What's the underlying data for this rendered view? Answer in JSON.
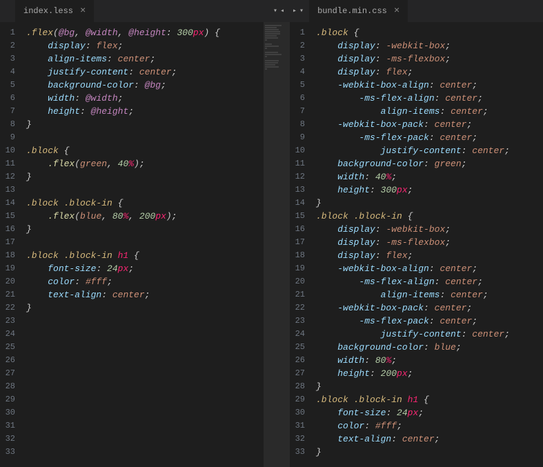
{
  "left": {
    "tab_title": "index.less",
    "lines": [
      [
        [
          "c-sel",
          ".flex"
        ],
        [
          "c-punc",
          "("
        ],
        [
          "c-var",
          "@bg"
        ],
        [
          "c-punc",
          ", "
        ],
        [
          "c-var",
          "@width"
        ],
        [
          "c-punc",
          ", "
        ],
        [
          "c-var",
          "@height"
        ],
        [
          "c-punc",
          ": "
        ],
        [
          "c-num",
          "300"
        ],
        [
          "c-unit",
          "px"
        ],
        [
          "c-punc",
          ") {"
        ]
      ],
      [
        [
          "",
          "    "
        ],
        [
          "c-prop",
          "display"
        ],
        [
          "c-punc",
          ": "
        ],
        [
          "c-val",
          "flex"
        ],
        [
          "c-punc",
          ";"
        ]
      ],
      [
        [
          "",
          "    "
        ],
        [
          "c-prop",
          "align-items"
        ],
        [
          "c-punc",
          ": "
        ],
        [
          "c-val",
          "center"
        ],
        [
          "c-punc",
          ";"
        ]
      ],
      [
        [
          "",
          "    "
        ],
        [
          "c-prop",
          "justify-content"
        ],
        [
          "c-punc",
          ": "
        ],
        [
          "c-val",
          "center"
        ],
        [
          "c-punc",
          ";"
        ]
      ],
      [
        [
          "",
          "    "
        ],
        [
          "c-prop",
          "background-color"
        ],
        [
          "c-punc",
          ": "
        ],
        [
          "c-var",
          "@bg"
        ],
        [
          "c-punc",
          ";"
        ]
      ],
      [
        [
          "",
          "    "
        ],
        [
          "c-prop",
          "width"
        ],
        [
          "c-punc",
          ": "
        ],
        [
          "c-var",
          "@width"
        ],
        [
          "c-punc",
          ";"
        ]
      ],
      [
        [
          "",
          "    "
        ],
        [
          "c-prop",
          "height"
        ],
        [
          "c-punc",
          ": "
        ],
        [
          "c-var",
          "@height"
        ],
        [
          "c-punc",
          ";"
        ]
      ],
      [
        [
          "c-punc",
          "}"
        ]
      ],
      [
        [
          "",
          ""
        ]
      ],
      [
        [
          "c-sel",
          ".block"
        ],
        [
          "c-punc",
          " {"
        ]
      ],
      [
        [
          "",
          "    "
        ],
        [
          "c-func",
          ".flex"
        ],
        [
          "c-punc",
          "("
        ],
        [
          "c-val",
          "green"
        ],
        [
          "c-punc",
          ", "
        ],
        [
          "c-num",
          "40"
        ],
        [
          "c-unit",
          "%"
        ],
        [
          "c-punc",
          ");"
        ]
      ],
      [
        [
          "c-punc",
          "}"
        ]
      ],
      [
        [
          "",
          ""
        ]
      ],
      [
        [
          "c-sel",
          ".block "
        ],
        [
          "c-sel",
          ".block-in"
        ],
        [
          "c-punc",
          " {"
        ]
      ],
      [
        [
          "",
          "    "
        ],
        [
          "c-func",
          ".flex"
        ],
        [
          "c-punc",
          "("
        ],
        [
          "c-val",
          "blue"
        ],
        [
          "c-punc",
          ", "
        ],
        [
          "c-num",
          "80"
        ],
        [
          "c-unit",
          "%"
        ],
        [
          "c-punc",
          ", "
        ],
        [
          "c-num",
          "200"
        ],
        [
          "c-unit",
          "px"
        ],
        [
          "c-punc",
          ");"
        ]
      ],
      [
        [
          "c-punc",
          "}"
        ]
      ],
      [
        [
          "",
          ""
        ]
      ],
      [
        [
          "c-sel",
          ".block "
        ],
        [
          "c-sel",
          ".block-in "
        ],
        [
          "c-tag",
          "h1"
        ],
        [
          "c-punc",
          " {"
        ]
      ],
      [
        [
          "",
          "    "
        ],
        [
          "c-prop",
          "font-size"
        ],
        [
          "c-punc",
          ": "
        ],
        [
          "c-num",
          "24"
        ],
        [
          "c-unit",
          "px"
        ],
        [
          "c-punc",
          ";"
        ]
      ],
      [
        [
          "",
          "    "
        ],
        [
          "c-prop",
          "color"
        ],
        [
          "c-punc",
          ": "
        ],
        [
          "c-val",
          "#fff"
        ],
        [
          "c-punc",
          ";"
        ]
      ],
      [
        [
          "",
          "    "
        ],
        [
          "c-prop",
          "text-align"
        ],
        [
          "c-punc",
          ": "
        ],
        [
          "c-val",
          "center"
        ],
        [
          "c-punc",
          ";"
        ]
      ],
      [
        [
          "c-punc",
          "}"
        ]
      ],
      [
        [
          "",
          ""
        ]
      ]
    ]
  },
  "right": {
    "tab_title": "bundle.min.css",
    "lines": [
      [
        [
          "c-sel",
          ".block"
        ],
        [
          "c-punc",
          " {"
        ]
      ],
      [
        [
          "",
          "    "
        ],
        [
          "c-prop",
          "display"
        ],
        [
          "c-punc",
          ": "
        ],
        [
          "c-val",
          "-webkit-box"
        ],
        [
          "c-punc",
          ";"
        ]
      ],
      [
        [
          "",
          "    "
        ],
        [
          "c-prop",
          "display"
        ],
        [
          "c-punc",
          ": "
        ],
        [
          "c-val",
          "-ms-flexbox"
        ],
        [
          "c-punc",
          ";"
        ]
      ],
      [
        [
          "",
          "    "
        ],
        [
          "c-prop",
          "display"
        ],
        [
          "c-punc",
          ": "
        ],
        [
          "c-val",
          "flex"
        ],
        [
          "c-punc",
          ";"
        ]
      ],
      [
        [
          "",
          "    "
        ],
        [
          "c-prop",
          "-webkit-box-align"
        ],
        [
          "c-punc",
          ": "
        ],
        [
          "c-val",
          "center"
        ],
        [
          "c-punc",
          ";"
        ]
      ],
      [
        [
          "",
          "        "
        ],
        [
          "c-prop",
          "-ms-flex-align"
        ],
        [
          "c-punc",
          ": "
        ],
        [
          "c-val",
          "center"
        ],
        [
          "c-punc",
          ";"
        ]
      ],
      [
        [
          "",
          "            "
        ],
        [
          "c-prop",
          "align-items"
        ],
        [
          "c-punc",
          ": "
        ],
        [
          "c-val",
          "center"
        ],
        [
          "c-punc",
          ";"
        ]
      ],
      [
        [
          "",
          "    "
        ],
        [
          "c-prop",
          "-webkit-box-pack"
        ],
        [
          "c-punc",
          ": "
        ],
        [
          "c-val",
          "center"
        ],
        [
          "c-punc",
          ";"
        ]
      ],
      [
        [
          "",
          "        "
        ],
        [
          "c-prop",
          "-ms-flex-pack"
        ],
        [
          "c-punc",
          ": "
        ],
        [
          "c-val",
          "center"
        ],
        [
          "c-punc",
          ";"
        ]
      ],
      [
        [
          "",
          "            "
        ],
        [
          "c-prop",
          "justify-content"
        ],
        [
          "c-punc",
          ": "
        ],
        [
          "c-val",
          "center"
        ],
        [
          "c-punc",
          ";"
        ]
      ],
      [
        [
          "",
          "    "
        ],
        [
          "c-prop",
          "background-color"
        ],
        [
          "c-punc",
          ": "
        ],
        [
          "c-val",
          "green"
        ],
        [
          "c-punc",
          ";"
        ]
      ],
      [
        [
          "",
          "    "
        ],
        [
          "c-prop",
          "width"
        ],
        [
          "c-punc",
          ": "
        ],
        [
          "c-num",
          "40"
        ],
        [
          "c-unit",
          "%"
        ],
        [
          "c-punc",
          ";"
        ]
      ],
      [
        [
          "",
          "    "
        ],
        [
          "c-prop",
          "height"
        ],
        [
          "c-punc",
          ": "
        ],
        [
          "c-num",
          "300"
        ],
        [
          "c-unit",
          "px"
        ],
        [
          "c-punc",
          ";"
        ]
      ],
      [
        [
          "c-punc",
          "}"
        ]
      ],
      [
        [
          "c-sel",
          ".block "
        ],
        [
          "c-sel",
          ".block-in"
        ],
        [
          "c-punc",
          " {"
        ]
      ],
      [
        [
          "",
          "    "
        ],
        [
          "c-prop",
          "display"
        ],
        [
          "c-punc",
          ": "
        ],
        [
          "c-val",
          "-webkit-box"
        ],
        [
          "c-punc",
          ";"
        ]
      ],
      [
        [
          "",
          "    "
        ],
        [
          "c-prop",
          "display"
        ],
        [
          "c-punc",
          ": "
        ],
        [
          "c-val",
          "-ms-flexbox"
        ],
        [
          "c-punc",
          ";"
        ]
      ],
      [
        [
          "",
          "    "
        ],
        [
          "c-prop",
          "display"
        ],
        [
          "c-punc",
          ": "
        ],
        [
          "c-val",
          "flex"
        ],
        [
          "c-punc",
          ";"
        ]
      ],
      [
        [
          "",
          "    "
        ],
        [
          "c-prop",
          "-webkit-box-align"
        ],
        [
          "c-punc",
          ": "
        ],
        [
          "c-val",
          "center"
        ],
        [
          "c-punc",
          ";"
        ]
      ],
      [
        [
          "",
          "        "
        ],
        [
          "c-prop",
          "-ms-flex-align"
        ],
        [
          "c-punc",
          ": "
        ],
        [
          "c-val",
          "center"
        ],
        [
          "c-punc",
          ";"
        ]
      ],
      [
        [
          "",
          "            "
        ],
        [
          "c-prop",
          "align-items"
        ],
        [
          "c-punc",
          ": "
        ],
        [
          "c-val",
          "center"
        ],
        [
          "c-punc",
          ";"
        ]
      ],
      [
        [
          "",
          "    "
        ],
        [
          "c-prop",
          "-webkit-box-pack"
        ],
        [
          "c-punc",
          ": "
        ],
        [
          "c-val",
          "center"
        ],
        [
          "c-punc",
          ";"
        ]
      ],
      [
        [
          "",
          "        "
        ],
        [
          "c-prop",
          "-ms-flex-pack"
        ],
        [
          "c-punc",
          ": "
        ],
        [
          "c-val",
          "center"
        ],
        [
          "c-punc",
          ";"
        ]
      ],
      [
        [
          "",
          "            "
        ],
        [
          "c-prop",
          "justify-content"
        ],
        [
          "c-punc",
          ": "
        ],
        [
          "c-val",
          "center"
        ],
        [
          "c-punc",
          ";"
        ]
      ],
      [
        [
          "",
          "    "
        ],
        [
          "c-prop",
          "background-color"
        ],
        [
          "c-punc",
          ": "
        ],
        [
          "c-val",
          "blue"
        ],
        [
          "c-punc",
          ";"
        ]
      ],
      [
        [
          "",
          "    "
        ],
        [
          "c-prop",
          "width"
        ],
        [
          "c-punc",
          ": "
        ],
        [
          "c-num",
          "80"
        ],
        [
          "c-unit",
          "%"
        ],
        [
          "c-punc",
          ";"
        ]
      ],
      [
        [
          "",
          "    "
        ],
        [
          "c-prop",
          "height"
        ],
        [
          "c-punc",
          ": "
        ],
        [
          "c-num",
          "200"
        ],
        [
          "c-unit",
          "px"
        ],
        [
          "c-punc",
          ";"
        ]
      ],
      [
        [
          "c-punc",
          "}"
        ]
      ],
      [
        [
          "c-sel",
          ".block "
        ],
        [
          "c-sel",
          ".block-in "
        ],
        [
          "c-tag",
          "h1"
        ],
        [
          "c-punc",
          " {"
        ]
      ],
      [
        [
          "",
          "    "
        ],
        [
          "c-prop",
          "font-size"
        ],
        [
          "c-punc",
          ": "
        ],
        [
          "c-num",
          "24"
        ],
        [
          "c-unit",
          "px"
        ],
        [
          "c-punc",
          ";"
        ]
      ],
      [
        [
          "",
          "    "
        ],
        [
          "c-prop",
          "color"
        ],
        [
          "c-punc",
          ": "
        ],
        [
          "c-val",
          "#fff"
        ],
        [
          "c-punc",
          ";"
        ]
      ],
      [
        [
          "",
          "    "
        ],
        [
          "c-prop",
          "text-align"
        ],
        [
          "c-punc",
          ": "
        ],
        [
          "c-val",
          "center"
        ],
        [
          "c-punc",
          ";"
        ]
      ],
      [
        [
          "c-punc",
          "}"
        ]
      ]
    ]
  }
}
